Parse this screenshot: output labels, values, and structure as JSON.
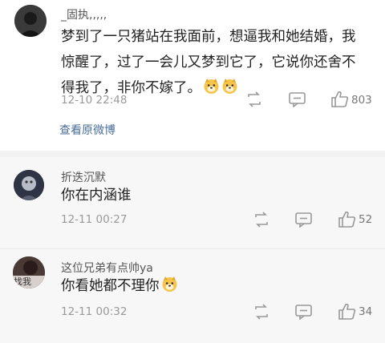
{
  "main_comment": {
    "username": "_固执,,,,,",
    "content": "梦到了一只猪站在我面前，想逼我和她结婚，我惊醒了，过了一会儿又梦到它了，它说你还舍不得我了，非你不嫁了。",
    "timestamp": "12-10 22:48",
    "likes": "803",
    "view_original": "查看原微博"
  },
  "replies": [
    {
      "username": "折迭沉默",
      "content": "你在内涵谁",
      "timestamp": "12-11 00:27",
      "likes": "52"
    },
    {
      "username": "这位兄弟有点帅ya",
      "content": "你看她都不理你",
      "timestamp": "12-11 00:32",
      "likes": "34",
      "avatar_text": "找我"
    }
  ],
  "colors": {
    "link": "#4a6d9a",
    "icon": "#999999",
    "emoji_face": "#f6c44a"
  },
  "icons": [
    "repost-icon",
    "comment-icon",
    "thumbs-up-icon",
    "doge-emoji-icon"
  ]
}
